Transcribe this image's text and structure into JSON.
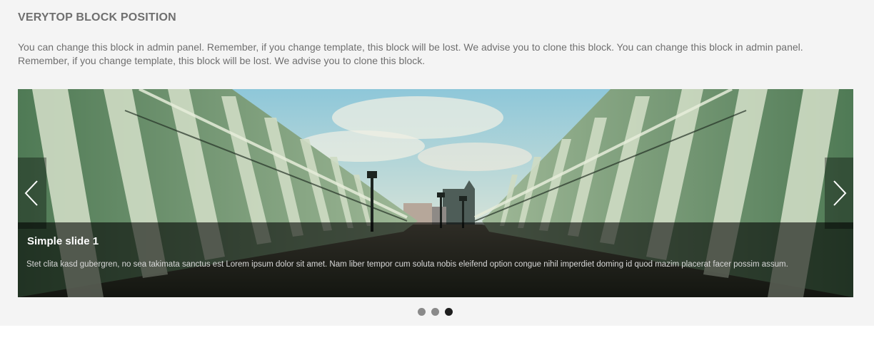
{
  "block": {
    "title": "VERYTOP BLOCK POSITION",
    "description": "You can change this block in admin panel. Remember, if you change template, this block will be lost. We advise you to clone this block. You can change this block in admin panel. Remember, if you change template, this block will be lost. We advise you to clone this block."
  },
  "slider": {
    "active_index": 2,
    "slide_count": 3,
    "caption": {
      "title": "Simple slide 1",
      "text": "Stet clita kasd gubergren, no sea takimata sanctus est Lorem ipsum dolor sit amet. Nam liber tempor cum soluta nobis eleifend option congue nihil imperdiet doming id quod mazim placerat facer possim assum."
    },
    "prev_icon": "chevron-left-icon",
    "next_icon": "chevron-right-icon"
  },
  "colors": {
    "background": "#f4f4f4",
    "heading": "#6f6f6f",
    "dot_inactive": "#8a8a8a",
    "dot_active": "#1e1e1e"
  }
}
